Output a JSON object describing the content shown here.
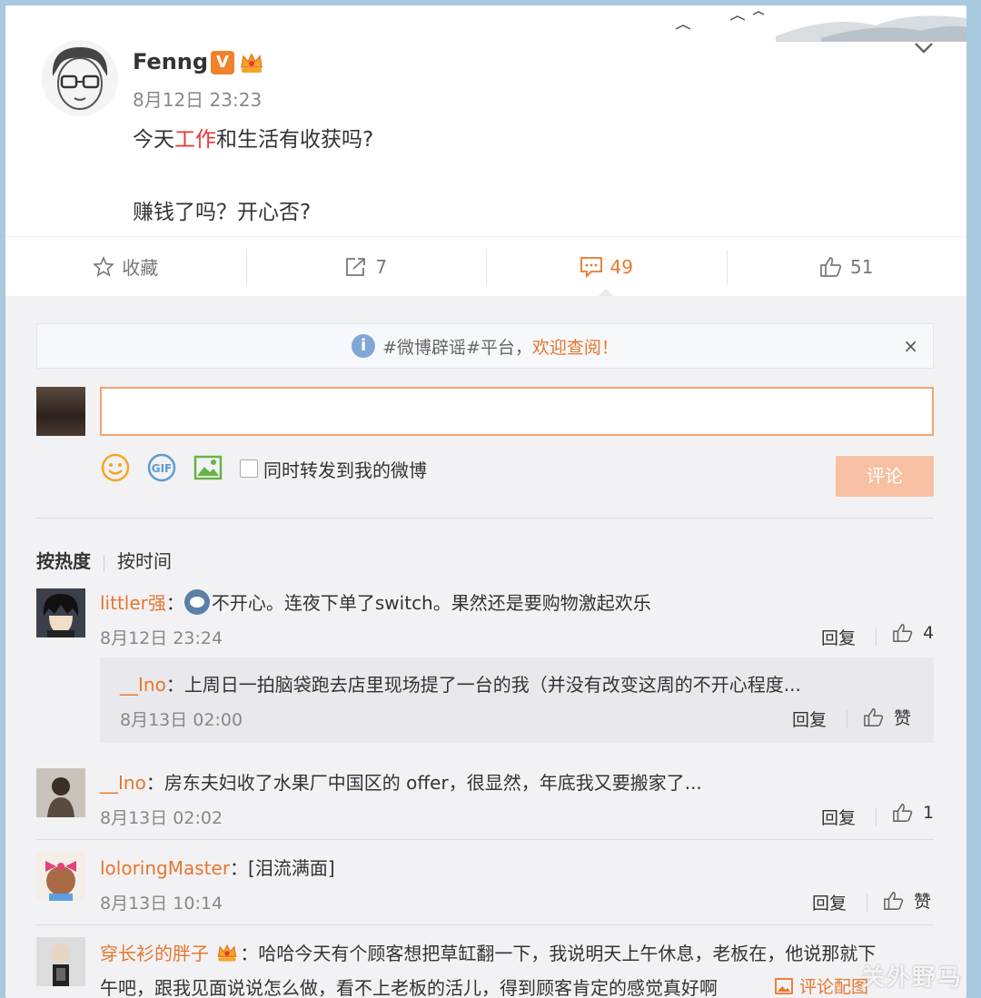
{
  "post": {
    "author": "Fenng",
    "verified_badge": "V",
    "time": "8月12日 23:23",
    "text_before": "今天",
    "text_highlight": "工作",
    "text_after": "和生活有收获吗?",
    "text_line2": "赚钱了吗？开心否?"
  },
  "actions": {
    "favorite_label": "收藏",
    "repost_count": "7",
    "comment_count": "49",
    "like_count": "51"
  },
  "notice": {
    "text": "#微博辟谣#平台，",
    "link": "欢迎查阅！",
    "close": "×"
  },
  "composer": {
    "input_value": "",
    "repost_label": "同时转发到我的微博",
    "submit_label": "评论"
  },
  "sort": {
    "hot": "按热度",
    "time": "按时间"
  },
  "comments": [
    {
      "user": "littler强",
      "colon": "：",
      "text": "不开心。连夜下单了switch。果然还是要购物激起欢乐",
      "time": "8月12日 23:24",
      "reply": "回复",
      "likes": "4"
    },
    {
      "user": "__Ino",
      "colon": "：",
      "text": "上周日一拍脑袋跑去店里现场提了一台的我（并没有改变这周的不开心程度...",
      "time": "8月13日 02:00",
      "reply": "回复",
      "likes": "赞"
    },
    {
      "user": "__Ino",
      "colon": "：",
      "text": "房东夫妇收了水果厂中国区的 offer，很显然，年底我又要搬家了...",
      "time": "8月13日 02:02",
      "reply": "回复",
      "likes": "1"
    },
    {
      "user": "loloringMaster",
      "colon": "：",
      "text": "[泪流满面]",
      "time": "8月13日 10:14",
      "reply": "回复",
      "likes": "赞"
    },
    {
      "user": "穿长衫的胖子",
      "colon": "：",
      "text": "哈哈今天有个顾客想把草缸翻一下，我说明天上午休息，老板在，他说那就下",
      "text2": "午吧，跟我见面说说怎么做，看不上老板的活儿，得到顾客肯定的感觉真好啊",
      "pic_link": "评论配图"
    }
  ],
  "watermark": "关外野马",
  "colors": {
    "accent": "#e8762c",
    "highlight": "#e33333",
    "submit_disabled": "#f7c0a2"
  }
}
